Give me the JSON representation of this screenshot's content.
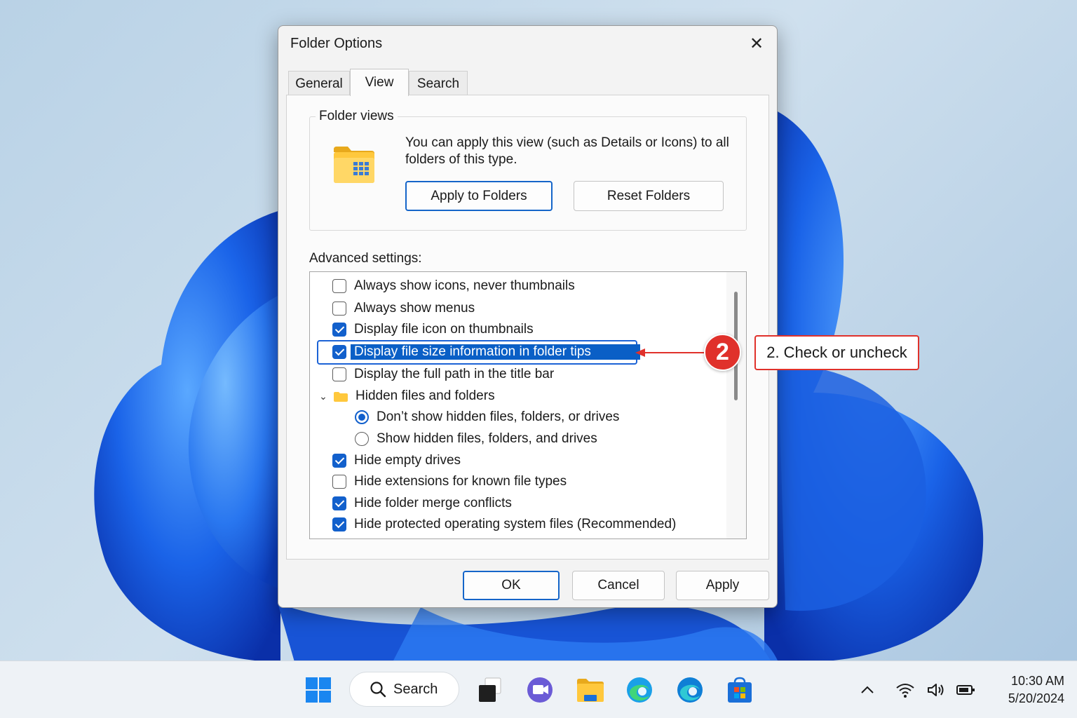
{
  "dialog": {
    "title": "Folder Options",
    "close_glyph": "✕",
    "tabs": [
      {
        "label": "General",
        "active": false
      },
      {
        "label": "View",
        "active": true
      },
      {
        "label": "Search",
        "active": false
      }
    ],
    "folder_views": {
      "legend": "Folder views",
      "description": "You can apply this view (such as Details or Icons) to all folders of this type.",
      "apply_button": "Apply to Folders",
      "reset_button": "Reset Folders"
    },
    "advanced": {
      "label": "Advanced settings:",
      "items": [
        {
          "type": "checkbox",
          "label": "Always show icons, never thumbnails",
          "checked": false
        },
        {
          "type": "checkbox",
          "label": "Always show menus",
          "checked": false
        },
        {
          "type": "checkbox",
          "label": "Display file icon on thumbnails",
          "checked": true
        },
        {
          "type": "checkbox",
          "label": "Display file size information in folder tips",
          "checked": true,
          "selected": true
        },
        {
          "type": "checkbox",
          "label": "Display the full path in the title bar",
          "checked": false
        },
        {
          "type": "folder",
          "label": "Hidden files and folders",
          "expanded": true
        },
        {
          "type": "radio",
          "label": "Don’t show hidden files, folders, or drives",
          "checked": true
        },
        {
          "type": "radio",
          "label": "Show hidden files, folders, and drives",
          "checked": false
        },
        {
          "type": "checkbox",
          "label": "Hide empty drives",
          "checked": true
        },
        {
          "type": "checkbox",
          "label": "Hide extensions for known file types",
          "checked": false
        },
        {
          "type": "checkbox",
          "label": "Hide folder merge conflicts",
          "checked": true
        },
        {
          "type": "checkbox",
          "label": "Hide protected operating system files (Recommended)",
          "checked": true
        }
      ]
    },
    "footer": {
      "ok": "OK",
      "cancel": "Cancel",
      "apply": "Apply"
    }
  },
  "callout": {
    "number": "2",
    "text": "2. Check or uncheck",
    "color": "#e0312b"
  },
  "taskbar": {
    "search_label": "Search",
    "apps": [
      "start-icon",
      "task-view-icon",
      "teams-chat-icon",
      "file-explorer-icon",
      "edge-icon",
      "edge-beta-icon",
      "store-icon"
    ],
    "tray": [
      "chevron-up-icon",
      "wifi-icon",
      "volume-icon",
      "battery-icon"
    ],
    "time": "10:30 AM",
    "date": "5/20/2024"
  },
  "colors": {
    "accent": "#1260cc",
    "highlight": "#0a5fc6",
    "callout": "#e0312b"
  }
}
